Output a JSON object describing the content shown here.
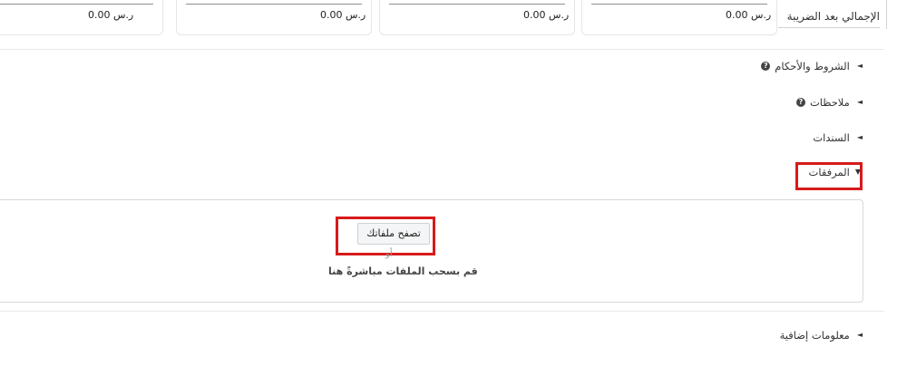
{
  "totals": {
    "label": "الإجمالي بعد الضريبة",
    "cards": [
      {
        "value": "0.00 ر.س"
      },
      {
        "value": "0.00 ر.س"
      },
      {
        "value": "0.00 ر.س"
      },
      {
        "value": "0.00 ر.س"
      }
    ]
  },
  "sections": {
    "terms": "الشروط والأحكام",
    "notes": "ملاحظات",
    "vouchers": "السندات",
    "attachments": "المرفقات",
    "extra_info": "معلومات إضافية"
  },
  "upload": {
    "browse_label": "تصفح ملفاتك",
    "or_label": "أو",
    "drag_label": "قم بسحب الملفات مباشرةً هنا"
  },
  "colors": {
    "highlight": "#d71a1a"
  }
}
